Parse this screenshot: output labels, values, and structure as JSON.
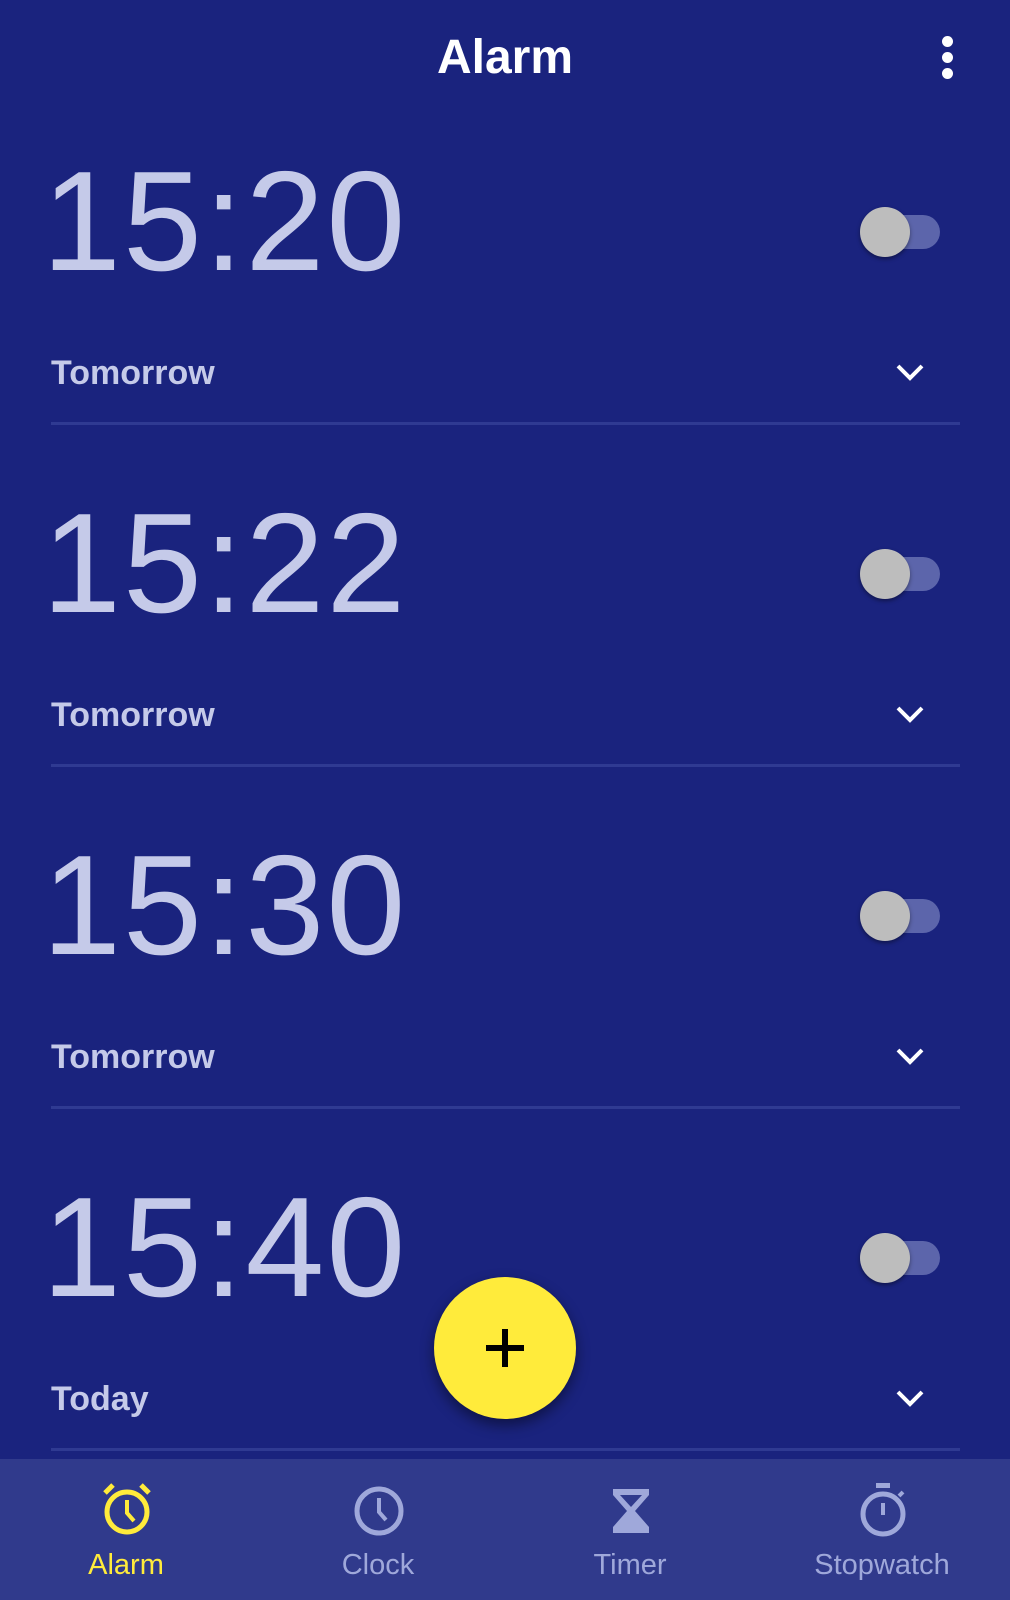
{
  "header": {
    "title": "Alarm",
    "more_icon": "more-vert-icon"
  },
  "alarms": [
    {
      "time": "15:20",
      "day": "Tomorrow",
      "enabled": false
    },
    {
      "time": "15:22",
      "day": "Tomorrow",
      "enabled": false
    },
    {
      "time": "15:30",
      "day": "Tomorrow",
      "enabled": false
    },
    {
      "time": "15:40",
      "day": "Today",
      "enabled": false
    }
  ],
  "fab": {
    "icon": "plus-icon"
  },
  "nav": [
    {
      "label": "Alarm",
      "icon": "alarm-icon",
      "active": true
    },
    {
      "label": "Clock",
      "icon": "clock-icon",
      "active": false
    },
    {
      "label": "Timer",
      "icon": "hourglass-icon",
      "active": false
    },
    {
      "label": "Stopwatch",
      "icon": "stopwatch-icon",
      "active": false
    }
  ],
  "colors": {
    "background": "#1a237e",
    "accent": "#ffeb3b",
    "nav_bg": "#303a8c",
    "inactive": "#9fa8da"
  }
}
